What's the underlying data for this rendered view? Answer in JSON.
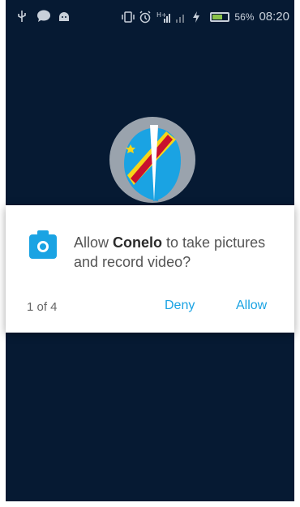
{
  "status_bar": {
    "icons_left": [
      "usb-icon",
      "chat-icon",
      "android-icon"
    ],
    "icons_right": [
      "vibrate-icon",
      "alarm-icon",
      "signal-h-plus-icon",
      "signal-icon",
      "charging-icon"
    ],
    "battery_percent": "56%",
    "time": "08:20"
  },
  "app": {
    "logo_colors": [
      "#1aa3e3",
      "#c8102e",
      "#f7d618"
    ]
  },
  "dialog": {
    "message_prefix": "Allow ",
    "app_name": "Conelo",
    "message_suffix": " to take pictures and record video?",
    "counter": "1 of 4",
    "deny_label": "Deny",
    "allow_label": "Allow",
    "accent": "#1aa3e3"
  }
}
